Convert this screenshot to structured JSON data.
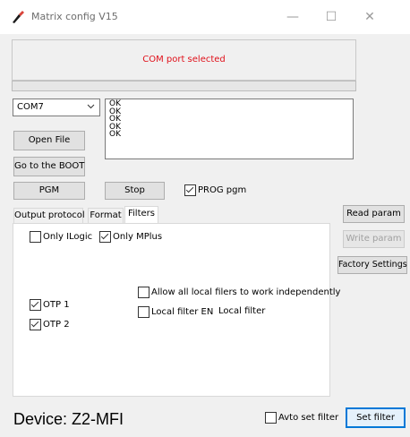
{
  "window": {
    "title": "Matrix config V15",
    "minimize": "—",
    "maximize": "☐",
    "close": "✕"
  },
  "status": {
    "message": "COM port selected",
    "progress": 0
  },
  "port": {
    "selected": "COM7"
  },
  "log": {
    "lines": [
      "OK",
      "OK",
      "OK",
      "OK",
      "OK"
    ]
  },
  "buttons": {
    "open_file": "Open File",
    "boot": "Go to the BOOT",
    "pgm": "PGM",
    "stop": "Stop",
    "read_param": "Read param",
    "write_param": "Write param",
    "factory": "Factory Settings",
    "set_filter": "Set filter"
  },
  "prog_pgm": {
    "label": "PROG pgm",
    "checked": true
  },
  "tabs": [
    {
      "label": "Output protocol",
      "active": false
    },
    {
      "label": "Format",
      "active": false
    },
    {
      "label": "Filters",
      "active": true
    }
  ],
  "filters": {
    "only_ilogic": {
      "label": "Only ILogic",
      "checked": false
    },
    "only_mplus": {
      "label": "Only MPlus",
      "checked": true
    },
    "allow_local": {
      "label": "Allow all local filers to work independently",
      "checked": false
    },
    "local_filter_en": {
      "label": "Local filter EN",
      "checked": false
    },
    "local_filter_label": "Local filter",
    "otp1": {
      "label": "OTP 1",
      "checked": true
    },
    "otp2": {
      "label": "OTP 2",
      "checked": true
    }
  },
  "device": {
    "label": "Device: Z2-MFI"
  },
  "avto_set_filter": {
    "label": "Avto set filter",
    "checked": false
  }
}
